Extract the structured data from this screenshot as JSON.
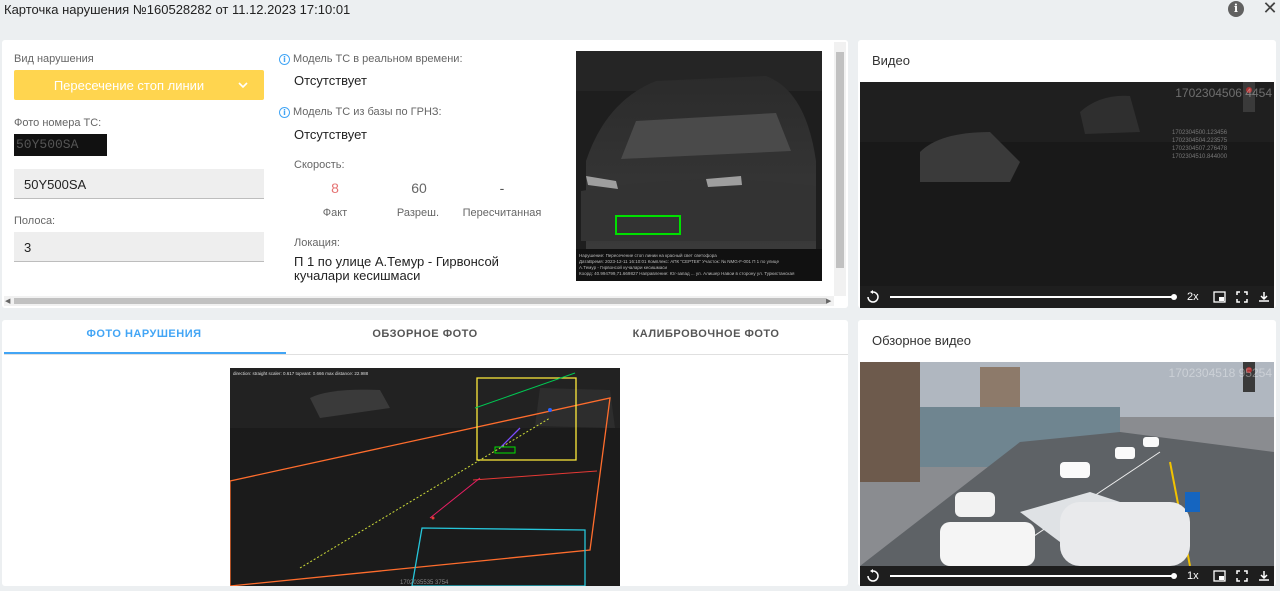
{
  "window": {
    "title": "Карточка нарушения №160528282 от 11.12.2023 17:10:01",
    "info_icon": "info-icon",
    "close_icon": "close-icon"
  },
  "details": {
    "violation_type_label": "Вид нарушения",
    "violation_type_value": "Пересечение стоп линии",
    "plate_photo_label": "Фото номера ТС:",
    "plate_photo_text": "50Y500SA",
    "plate_value": "50Y500SA",
    "lane_label": "Полоса:",
    "lane_value": "3",
    "model_realtime_label": "Модель ТС в реальном времени:",
    "model_realtime_value": "Отсутствует",
    "model_db_label": "Модель ТС из базы по ГРНЗ:",
    "model_db_value": "Отсутствует",
    "speed_label": "Скорость:",
    "speed_fact": "8",
    "speed_fact_label": "Факт",
    "speed_allowed": "60",
    "speed_allowed_label": "Разреш.",
    "speed_recalc": "-",
    "speed_recalc_label": "Пересчитанная",
    "location_label": "Локация:",
    "location_value": "П 1 по улице А.Темур - Гирвонсой кучалари кесишмаси"
  },
  "tabs": [
    {
      "label": "ФОТО НАРУШЕНИЯ",
      "active": true
    },
    {
      "label": "ОБЗОРНОЕ ФОТО",
      "active": false
    },
    {
      "label": "КАЛИБРОВОЧНОЕ ФОТО",
      "active": false
    }
  ],
  "video": {
    "title": "Видео",
    "timestamp": "1702304506 4454",
    "speed": "2x"
  },
  "overview_video": {
    "title": "Обзорное видео",
    "timestamp": "1702304518 95254",
    "speed": "1x"
  },
  "colors": {
    "accent": "#42a5f5",
    "select_bg": "#ffd54f",
    "speed_fact": "#e57373",
    "plate_box": "#00e000"
  }
}
